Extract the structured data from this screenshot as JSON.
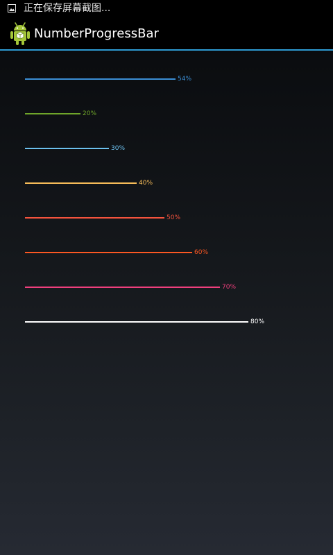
{
  "status_bar": {
    "notification_text": "正在保存屏幕截图...",
    "icon": "image-icon"
  },
  "action_bar": {
    "title": "NumberProgressBar",
    "icon": "android-robot-icon",
    "accent_color": "#2e9bd3"
  },
  "progress_bars": [
    {
      "label": "54%",
      "value": 54,
      "color": "#3b8fd6"
    },
    {
      "label": "20%",
      "value": 20,
      "color": "#6fa52a"
    },
    {
      "label": "30%",
      "value": 30,
      "color": "#6cc0ee"
    },
    {
      "label": "40%",
      "value": 40,
      "color": "#f7bd59"
    },
    {
      "label": "50%",
      "value": 50,
      "color": "#f5533d"
    },
    {
      "label": "60%",
      "value": 60,
      "color": "#fb5722"
    },
    {
      "label": "70%",
      "value": 70,
      "color": "#ef3f7d"
    },
    {
      "label": "80%",
      "value": 80,
      "color": "#ffffff"
    }
  ]
}
